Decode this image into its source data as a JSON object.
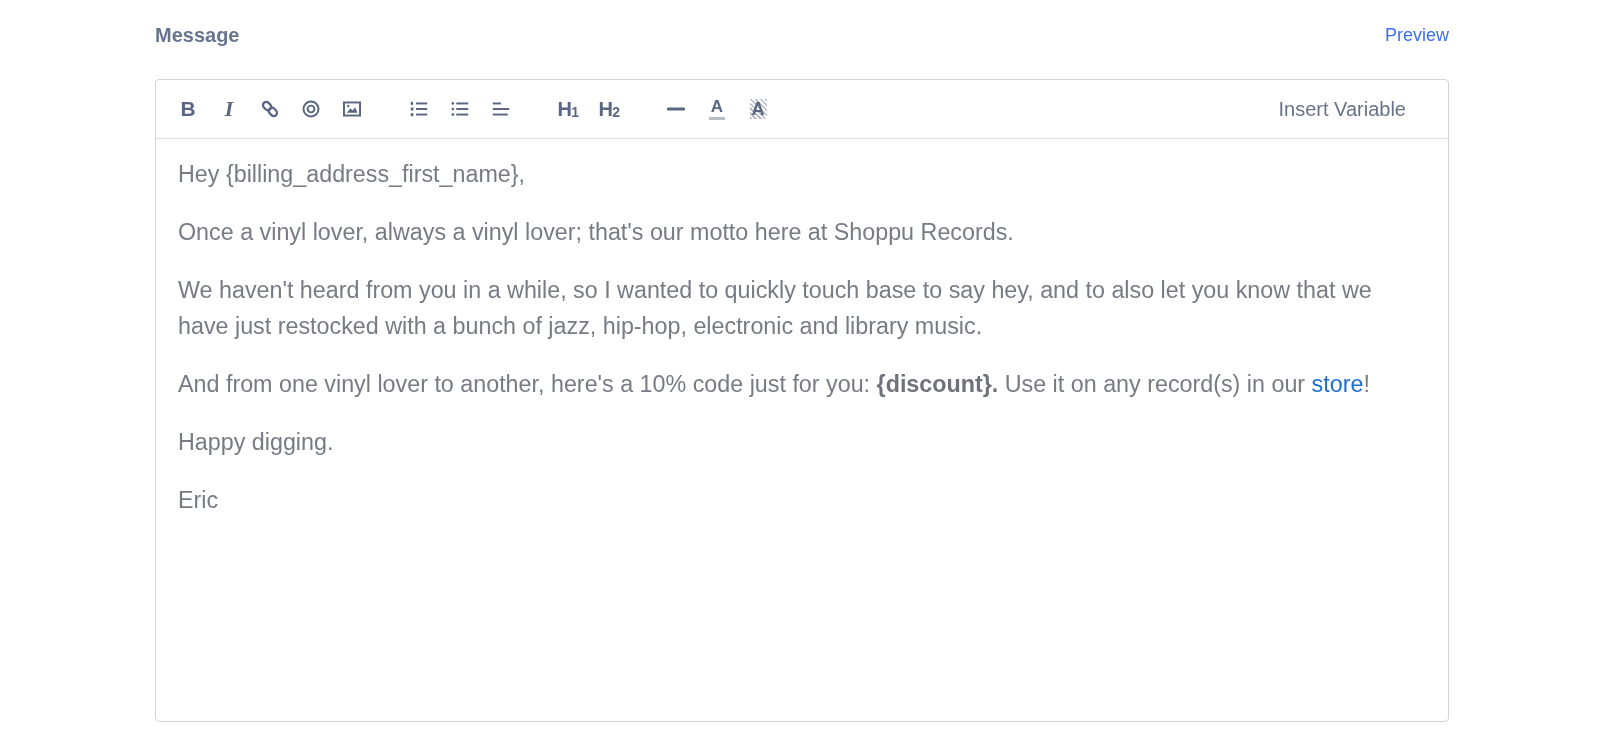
{
  "header": {
    "label": "Message",
    "preview_link": "Preview"
  },
  "toolbar": {
    "groups": [
      [
        {
          "kind": "bold",
          "label": "B"
        },
        {
          "kind": "italic",
          "label": "I"
        },
        {
          "kind": "link"
        },
        {
          "kind": "target"
        },
        {
          "kind": "image"
        }
      ],
      [
        {
          "kind": "ordered_list"
        },
        {
          "kind": "bullet_list"
        },
        {
          "kind": "align_left"
        }
      ],
      [
        {
          "kind": "heading",
          "label": "H$_{1}$"
        },
        {
          "kind": "heading",
          "label": "H$_{2}$"
        }
      ],
      [
        {
          "kind": "rule"
        },
        {
          "kind": "text_color",
          "label": "A"
        },
        {
          "kind": "highlight",
          "label": "A"
        }
      ]
    ],
    "insert_variable": "Insert Variable"
  },
  "message": {
    "paragraphs": [
      [
        {
          "kind": "text",
          "text": "Hey {billing_address_first_name},"
        }
      ],
      [
        {
          "kind": "text",
          "text": "Once a vinyl lover, always a vinyl lover; that's our motto here at Shoppu Records."
        }
      ],
      [
        {
          "kind": "text",
          "text": "We haven't heard from you in a while, so I wanted to quickly touch base to say hey, and to also let you know that we have just restocked with a bunch of jazz, hip-hop, electronic and library music."
        }
      ],
      [
        {
          "kind": "text",
          "text": "And from one vinyl lover to another, here's a 10% code just for you: **{discount}.** Use it on any record(s) in our "
        },
        {
          "kind": "link",
          "text": "store"
        },
        {
          "kind": "text",
          "text": "!"
        }
      ],
      [
        {
          "kind": "text",
          "text": "Happy digging."
        }
      ],
      [
        {
          "kind": "text",
          "text": "Eric"
        }
      ]
    ]
  }
}
